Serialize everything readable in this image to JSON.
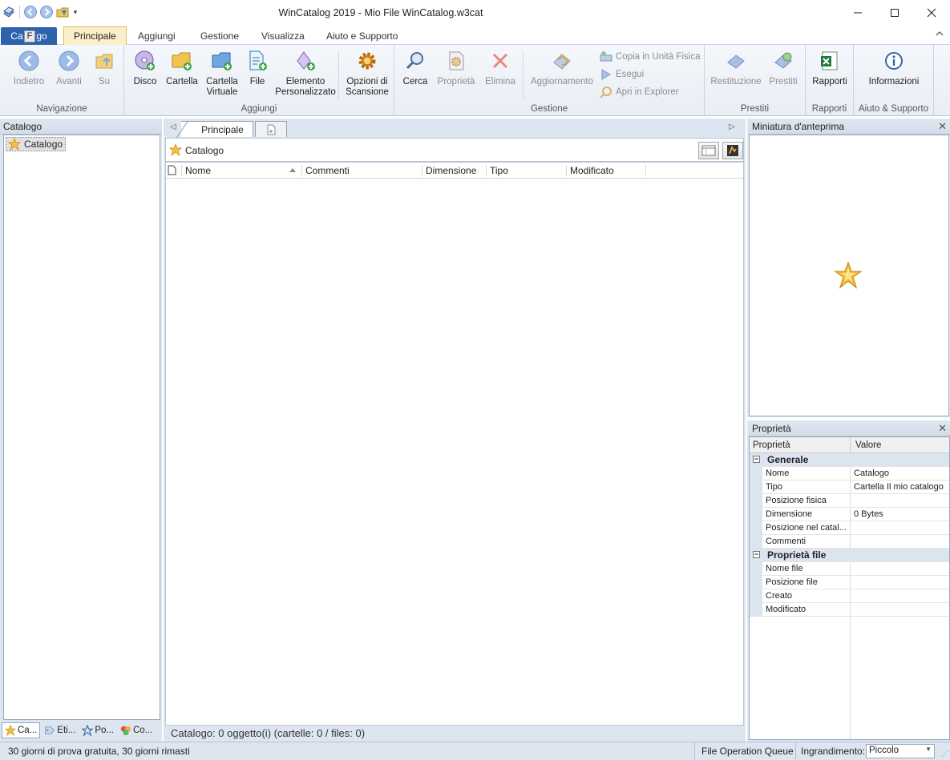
{
  "window": {
    "title": "WinCatalog 2019 - Mio File WinCatalog.w3cat"
  },
  "ribbon_tabs": {
    "file_pre": "Ca",
    "file_key": "F",
    "file_post": "go",
    "tabs": [
      "Principale",
      "Aggiungi",
      "Gestione",
      "Visualizza",
      "Aiuto e Supporto"
    ],
    "active_index": 0
  },
  "ribbon": {
    "navigazione": {
      "label": "Navigazione",
      "indietro": "Indietro",
      "avanti": "Avanti",
      "su": "Su"
    },
    "aggiungi": {
      "label": "Aggiungi",
      "disco": "Disco",
      "cartella": "Cartella",
      "cartella_virtuale": "Cartella Virtuale",
      "file": "File",
      "elemento": "Elemento Personalizzato",
      "opzioni": "Opzioni di Scansione"
    },
    "gestione": {
      "label": "Gestione",
      "cerca": "Cerca",
      "proprieta": "Proprietà",
      "elimina": "Elimina",
      "aggiornamento": "Aggiornamento",
      "copia": "Copia in Unità Fisica",
      "esegui": "Esegui",
      "apri": "Apri in Explorer"
    },
    "prestiti": {
      "label": "Prestiti",
      "restituzione": "Restituzione",
      "prestiti": "Prestiti"
    },
    "rapporti": {
      "label": "Rapporti",
      "rapporti": "Rapporti"
    },
    "aiuto": {
      "label": "Aiuto & Supporto",
      "informazioni": "Informazioni"
    }
  },
  "left_panel": {
    "title": "Catalogo",
    "tree_root": "Catalogo",
    "bottom_tabs": [
      "Ca...",
      "Eti...",
      "Po...",
      "Co..."
    ]
  },
  "center": {
    "tab_label": "Principale",
    "path": "Catalogo",
    "columns": [
      "Nome",
      "Commenti",
      "Dimensione",
      "Tipo",
      "Modificato"
    ],
    "status": "Catalogo: 0 oggetto(i) (cartelle: 0 / files: 0)"
  },
  "preview_panel": {
    "title": "Miniatura d'anteprima"
  },
  "properties_panel": {
    "title": "Proprietà",
    "col_property": "Proprietà",
    "col_value": "Valore",
    "groups": [
      {
        "name": "Generale",
        "rows": [
          {
            "name": "Nome",
            "value": "Catalogo"
          },
          {
            "name": "Tipo",
            "value": "Cartella Il mio catalogo"
          },
          {
            "name": "Posizione fisica",
            "value": ""
          },
          {
            "name": "Dimensione",
            "value": "0 Bytes"
          },
          {
            "name": "Posizione nel catal...",
            "value": ""
          },
          {
            "name": "Commenti",
            "value": ""
          }
        ]
      },
      {
        "name": "Proprietà file",
        "rows": [
          {
            "name": "Nome file",
            "value": ""
          },
          {
            "name": "Posizione file",
            "value": ""
          },
          {
            "name": "Creato",
            "value": ""
          },
          {
            "name": "Modificato",
            "value": ""
          }
        ]
      }
    ]
  },
  "statusbar": {
    "trial": "30 giorni di prova gratuita, 30 giorni rimasti",
    "queue": "File Operation Queue",
    "zoom_label": "Ingrandimento:",
    "zoom_value": "Piccolo"
  }
}
